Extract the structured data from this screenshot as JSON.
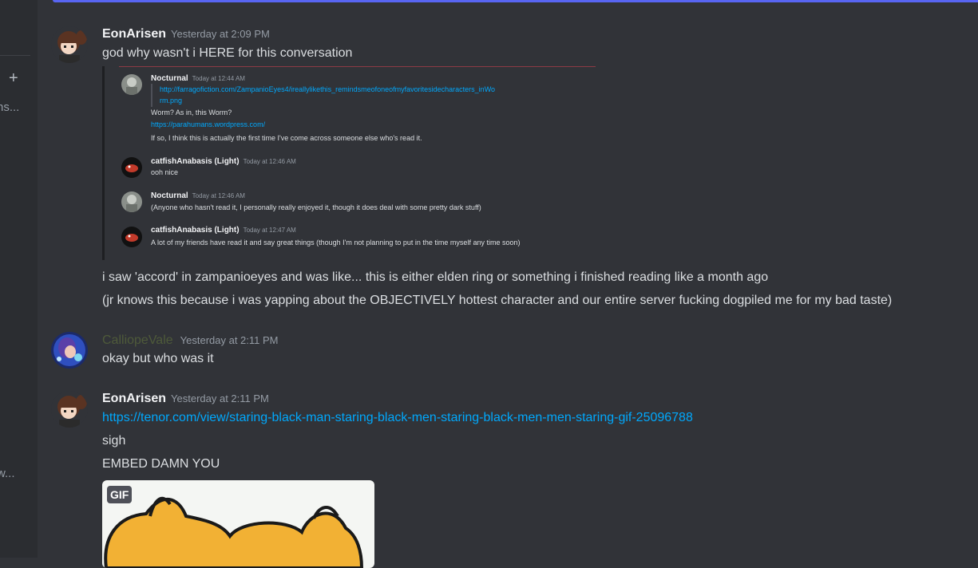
{
  "sidebar": {
    "add_label": "+",
    "trunc_top": "ns...",
    "trunc_bottom": "w..."
  },
  "messages": [
    {
      "author": "EonArisen",
      "timestamp": "Yesterday at 2:09 PM",
      "lines": [
        "god why wasn't i HERE for this conversation"
      ],
      "after_lines": [
        "i saw 'accord' in zampanioeyes and was like... this is either elden ring or something i finished reading like a month ago",
        "(jr knows this because i was yapping about the OBJECTIVELY hottest character and our entire server fucking dogpiled me for my bad taste)"
      ]
    },
    {
      "author": "CalliopeVale",
      "timestamp": "Yesterday at 2:11 PM",
      "lines": [
        "okay but who was it"
      ]
    },
    {
      "author": "EonArisen",
      "timestamp": "Yesterday at 2:11 PM",
      "link": "https://tenor.com/view/staring-black-man-staring-black-men-staring-black-men-men-staring-gif-25096788",
      "lines": [
        "sigh",
        "EMBED DAMN YOU"
      ],
      "gif_badge": "GIF"
    }
  ],
  "embedded": [
    {
      "author": "Nocturnal",
      "timestamp": "Today at 12:44 AM",
      "link1": "http://farragofiction.com/ZampanioEyes4/ireallylikethis_remindsmeofoneofmyfavoritesidecharacters_inWo",
      "link2": "rm.png",
      "line1": "Worm? As in, this Worm?",
      "link3": "https://parahumans.wordpress.com/",
      "line2": "If so, I think this is actually the first time I've come across someone else who's read it."
    },
    {
      "author": "catfishAnabasis (Light)",
      "timestamp": "Today at 12:46 AM",
      "line1": "ooh nice"
    },
    {
      "author": "Nocturnal",
      "timestamp": "Today at 12:46 AM",
      "line1": "(Anyone who hasn't read it, I personally really enjoyed it, though it does deal with some pretty dark stuff)"
    },
    {
      "author": "catfishAnabasis (Light)",
      "timestamp": "Today at 12:47 AM",
      "line1": "A lot of my friends have read it and say great things (though I'm not planning to put in the time myself any time soon)"
    }
  ]
}
